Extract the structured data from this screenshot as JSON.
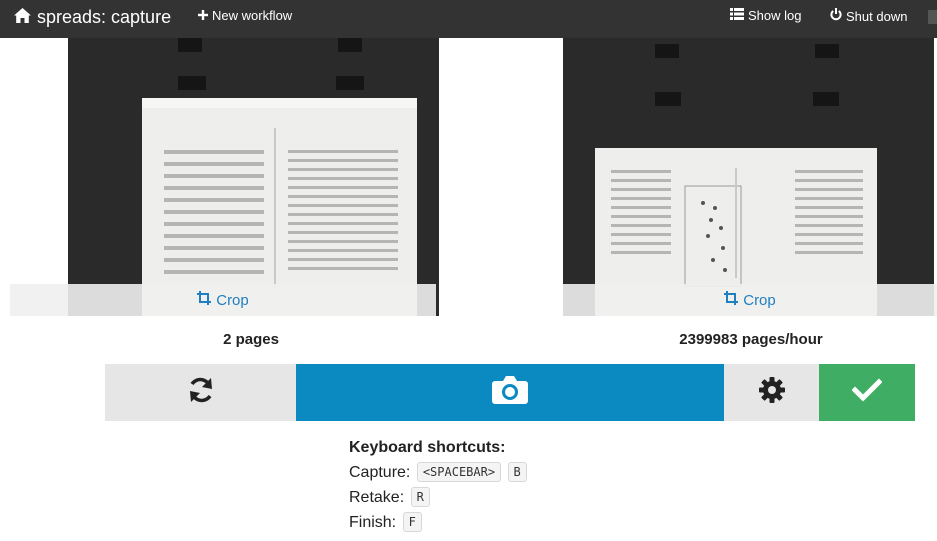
{
  "header": {
    "brand": "spreads: capture",
    "new_workflow": "New workflow",
    "show_log": "Show log",
    "shut_down": "Shut down"
  },
  "previews": {
    "left": {
      "crop_label": "Crop"
    },
    "right": {
      "crop_label": "Crop"
    }
  },
  "stats": {
    "pages": "2 pages",
    "rate": "2399983 pages/hour"
  },
  "actions": {
    "retake_icon": "refresh-icon",
    "capture_icon": "camera-icon",
    "config_icon": "gear-icon",
    "finish_icon": "check-icon"
  },
  "shortcuts": {
    "heading": "Keyboard shortcuts:",
    "capture_label": "Capture:",
    "capture_keys": [
      "<SPACEBAR>",
      "B"
    ],
    "retake_label": "Retake:",
    "retake_keys": [
      "R"
    ],
    "finish_label": "Finish:",
    "finish_keys": [
      "F"
    ]
  },
  "colors": {
    "topbar": "#333333",
    "capture": "#0a8ac1",
    "finish": "#3fae64",
    "neutral": "#e6e6e6",
    "link": "#1f7fbf"
  }
}
